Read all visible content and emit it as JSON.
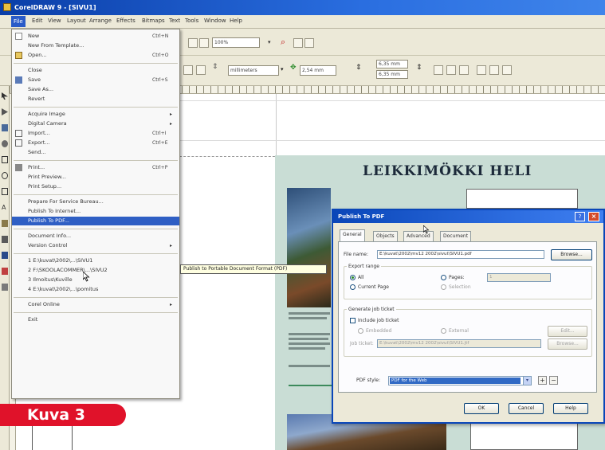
{
  "window": {
    "title": "CorelDRAW 9 - [SIVU1]"
  },
  "menubar": {
    "items": [
      "File",
      "Edit",
      "View",
      "Layout",
      "Arrange",
      "Effects",
      "Bitmaps",
      "Text",
      "Tools",
      "Window",
      "Help"
    ]
  },
  "toolbar": {
    "zoom": "100%",
    "units": "millimeters",
    "nudge": "2,54 mm",
    "dupx": "6,35 mm",
    "dupy": "6,35 mm"
  },
  "file_menu": {
    "items": [
      {
        "label": "New",
        "shortcut": "Ctrl+N"
      },
      {
        "label": "New From Template..."
      },
      {
        "label": "Open...",
        "shortcut": "Ctrl+O"
      },
      {
        "label": "Close"
      },
      {
        "label": "Save",
        "shortcut": "Ctrl+S"
      },
      {
        "label": "Save As..."
      },
      {
        "label": "Revert"
      },
      {
        "label": "Acquire Image"
      },
      {
        "label": "Digital Camera"
      },
      {
        "label": "Import...",
        "shortcut": "Ctrl+I"
      },
      {
        "label": "Export...",
        "shortcut": "Ctrl+E"
      },
      {
        "label": "Send..."
      },
      {
        "label": "Print...",
        "shortcut": "Ctrl+P"
      },
      {
        "label": "Print Preview..."
      },
      {
        "label": "Print Setup..."
      },
      {
        "label": "Prepare For Service Bureau..."
      },
      {
        "label": "Publish To Internet..."
      },
      {
        "label": "Publish To PDF..."
      },
      {
        "label": "Document Info..."
      },
      {
        "label": "Version Control"
      },
      {
        "label": "1 E:\\kuvat\\2002\\...\\SIVU1"
      },
      {
        "label": "2 F:\\SKOOLACOMMER\\...\\SIVU2"
      },
      {
        "label": "3 Ilmoitus\\Kuville"
      },
      {
        "label": "4 E:\\kuvat\\2002\\...\\pomitus"
      },
      {
        "label": "Corel Online"
      },
      {
        "label": "Exit"
      }
    ],
    "tooltip": "Publish to Portable Document Format (PDF)"
  },
  "document": {
    "title": "LEIKKIMÖKKI HELI"
  },
  "dialog": {
    "title": "Publish To PDF",
    "help": "?",
    "close": "×",
    "tabs": [
      "General",
      "Objects",
      "Advanced",
      "Document"
    ],
    "file_name_label": "File name:",
    "file_name_value": "E:\\kuvat\\2002\\mv12 2002\\sivut\\SIVU1.pdf",
    "browse": "Browse...",
    "export_range": "Export range",
    "all": "All",
    "current_page": "Current Page",
    "pages": "Pages:",
    "pages_value": "1",
    "selection": "Selection",
    "generate_job_ticket": "Generate job ticket",
    "include_job_ticket": "Include job ticket",
    "embedded": "Embedded",
    "external": "External",
    "ticket_name_label": "Job ticket:",
    "ticket_name_value": "E:\\kuvat\\2002\\mv12 2002\\sivut\\SIVU1.jtf",
    "ticket_btn1": "Edit...",
    "ticket_btn2": "Browse...",
    "pdf_style_label": "PDF style:",
    "pdf_style_value": "PDF for the Web",
    "plus": "+",
    "minus": "−",
    "ok": "OK",
    "cancel": "Cancel",
    "help_btn": "Help"
  },
  "caption": "Kuva 3",
  "colors": {
    "titlebar": "#0a3ea8",
    "menu_highlight": "#2f5fc4",
    "badge": "#e0122a",
    "page_bg": "#c9ddd5"
  }
}
